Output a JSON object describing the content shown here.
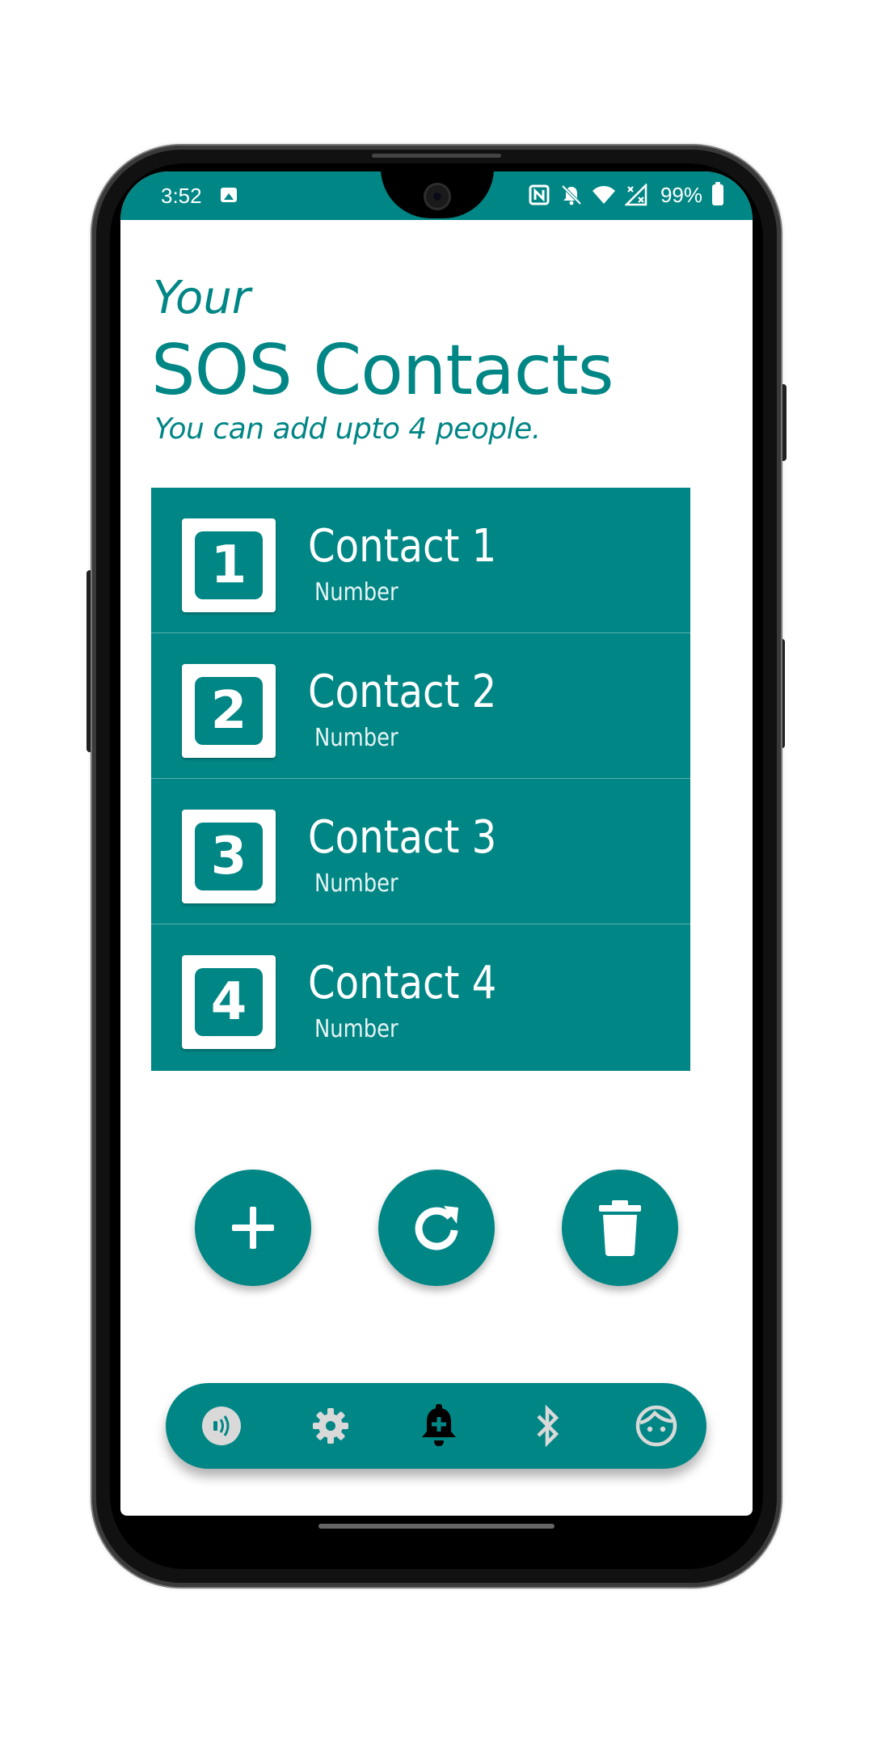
{
  "status_bar": {
    "time": "3:52",
    "battery_percent": "99%",
    "icons": [
      "image-icon",
      "nfc-icon",
      "bell-off-icon",
      "wifi-icon",
      "no-signal-icon",
      "battery-icon"
    ]
  },
  "header": {
    "overline": "Your",
    "title": "SOS Contacts",
    "subtitle": "You can add upto 4 people."
  },
  "contacts": [
    {
      "badge": "1",
      "name": "Contact 1",
      "number": "Number"
    },
    {
      "badge": "2",
      "name": "Contact 2",
      "number": "Number"
    },
    {
      "badge": "3",
      "name": "Contact 3",
      "number": "Number"
    },
    {
      "badge": "4",
      "name": "Contact 4",
      "number": "Number"
    }
  ],
  "actions": {
    "add": "plus-icon",
    "refresh": "refresh-icon",
    "delete": "trash-icon"
  },
  "bottom_nav": {
    "items": [
      "nearby-icon",
      "settings-icon",
      "sos-bell-icon",
      "bluetooth-icon",
      "face-icon"
    ],
    "active": "sos-bell-icon"
  },
  "colors": {
    "primary": "#008685",
    "on_primary": "#ffffff",
    "active_nav": "#000000",
    "inactive_nav": "#d9d9d9"
  }
}
